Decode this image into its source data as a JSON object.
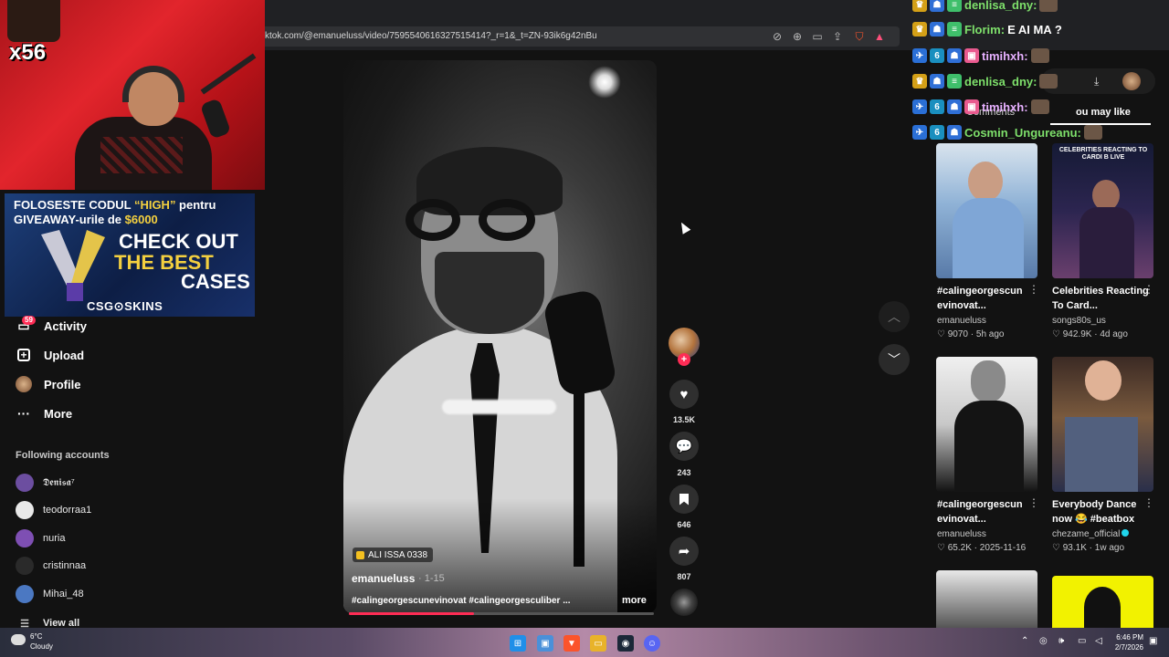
{
  "browser": {
    "url": "ktok.com/@emanueluss/video/7595540616327515414?_r=1&_t=ZN-93ik6g42nBu"
  },
  "stream_overlay": {
    "multiplier": "x56",
    "promo_line1_prefix": "FOLOSESTE CODUL ",
    "promo_code": "“HIGH”",
    "promo_line1_suffix": " pentru",
    "promo_line2_prefix": "GIVEAWAY-urile de ",
    "promo_amount": "$6000",
    "promo_cta1": "CHECK OUT",
    "promo_cta2": "THE BEST",
    "promo_cta3": "CASES",
    "promo_brand": "CSG⊙SKINS"
  },
  "sidebar": {
    "activity_badge": "59",
    "items": [
      {
        "label": "Activity",
        "icon": "inbox-icon"
      },
      {
        "label": "Upload",
        "icon": "plus-square-icon"
      },
      {
        "label": "Profile",
        "icon": "avatar-icon"
      },
      {
        "label": "More",
        "icon": "ellipsis-icon"
      }
    ],
    "following_title": "Following accounts",
    "accounts": [
      {
        "name": "𝕯𝖊𝖓𝖎𝖘𝖆⁷",
        "color": "#6c4ea0"
      },
      {
        "name": "teodorraa1",
        "color": "#e8e8e8"
      },
      {
        "name": "nuria",
        "color": "#7e4fb3"
      },
      {
        "name": "cristinnaa",
        "color": "#2a2a2a"
      },
      {
        "name": "Mihai_48",
        "color": "#4b78c2"
      }
    ],
    "view_all": "View all"
  },
  "video": {
    "sound_label": "ALI ISSA 0338",
    "author": "emanueluss",
    "date": "· 1-15",
    "caption": "#calingeorgescunevinovat #calingeorgesculiber ...",
    "more": "more",
    "progress": 0.41,
    "likes": "13.5K",
    "comments": "243",
    "bookmarks": "646",
    "shares": "807"
  },
  "right_panel": {
    "tab_comments": "Comments",
    "tab_you_may_like": "ou may like",
    "cards": [
      {
        "title": "#calingeorgescun evinovat...",
        "author": "emanueluss",
        "verified": false,
        "likes": "9070",
        "age": "5h ago",
        "thumb_text": "",
        "bg1": "#d9e4ee",
        "bg2": "#587aa8"
      },
      {
        "title": "Celebrities Reacting To Card...",
        "author": "songs80s_us",
        "verified": false,
        "likes": "942.9K",
        "age": "4d ago",
        "thumb_text": "CELEBRITIES REACTING TO CARDI B LIVE",
        "bg1": "#151a35",
        "bg2": "#6a3f6d"
      },
      {
        "title": "#calingeorgescun evinovat...",
        "author": "emanueluss",
        "verified": false,
        "likes": "65.2K",
        "age": "2025-11-16",
        "thumb_text": "",
        "bg1": "#e8e8e8",
        "bg2": "#121212"
      },
      {
        "title": "Everybody Dance now 😂 #beatbox",
        "author": "chezame_official",
        "verified": true,
        "likes": "93.1K",
        "age": "1w ago",
        "thumb_text": "",
        "bg1": "#3b2a24",
        "bg2": "#7a5a3e"
      }
    ],
    "extra_thumbs": [
      {
        "bg": "#1a1a1a"
      },
      {
        "bg": "#f2f200"
      }
    ]
  },
  "chat": [
    {
      "user": "denlisa_dny:",
      "msg": "",
      "color": "#7ee06b"
    },
    {
      "user": "Florim:",
      "msg": "E AI MA ?",
      "color": "#7ee06b"
    },
    {
      "user": "timihxh:",
      "msg": "",
      "color": "#e7b0ff"
    },
    {
      "user": "denlisa_dny:",
      "msg": "",
      "color": "#7ee06b"
    },
    {
      "user": "timihxh:",
      "msg": "",
      "color": "#e7b0ff"
    },
    {
      "user": "Cosmin_Ungureanu:",
      "msg": "",
      "color": "#7ee06b"
    }
  ],
  "taskbar": {
    "temp": "6°C",
    "weather": "Cloudy",
    "time": "6:46 PM",
    "date": "2/7/2026"
  }
}
